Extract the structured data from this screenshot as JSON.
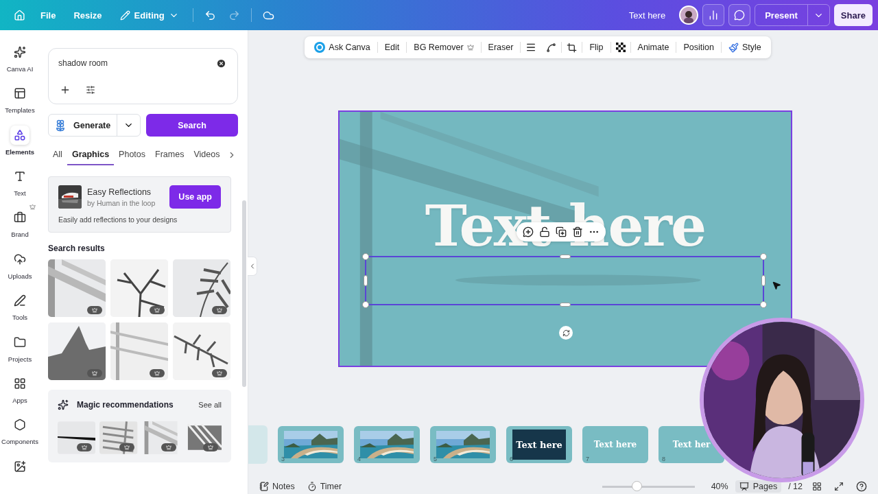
{
  "topbar": {
    "menu": [
      "File",
      "Resize"
    ],
    "mode": "Editing",
    "design_title": "Text here",
    "present": "Present",
    "share": "Share"
  },
  "rail": [
    {
      "label": "Canva AI",
      "selected": false,
      "premium": false
    },
    {
      "label": "Templates",
      "selected": false,
      "premium": false
    },
    {
      "label": "Elements",
      "selected": true,
      "premium": false
    },
    {
      "label": "Text",
      "selected": false,
      "premium": false
    },
    {
      "label": "Brand",
      "selected": false,
      "premium": true
    },
    {
      "label": "Uploads",
      "selected": false,
      "premium": false
    },
    {
      "label": "Tools",
      "selected": false,
      "premium": false
    },
    {
      "label": "Projects",
      "selected": false,
      "premium": false
    },
    {
      "label": "Apps",
      "selected": false,
      "premium": false
    },
    {
      "label": "Components",
      "selected": false,
      "premium": false
    },
    {
      "selected": false,
      "premium": false
    }
  ],
  "panel": {
    "search": {
      "value": "shadow room"
    },
    "generate": "Generate",
    "search_button": "Search",
    "tabs": [
      {
        "label": "All",
        "selected": false
      },
      {
        "label": "Graphics",
        "selected": true
      },
      {
        "label": "Photos",
        "selected": false
      },
      {
        "label": "Frames",
        "selected": false
      },
      {
        "label": "Videos",
        "selected": false
      }
    ],
    "app_card": {
      "title": "Easy Reflections",
      "author": "by Human in the loop",
      "button": "Use app",
      "description": "Easily add reflections to your designs"
    },
    "results_title": "Search results",
    "results": [
      {
        "kind": "window"
      },
      {
        "kind": "branches"
      },
      {
        "kind": "palm"
      },
      {
        "kind": "city"
      },
      {
        "kind": "frame"
      },
      {
        "kind": "leaves"
      }
    ],
    "magic": {
      "title": "Magic recommendations",
      "link": "See all",
      "items": [
        {
          "kind": "line"
        },
        {
          "kind": "blinds"
        },
        {
          "kind": "window"
        },
        {
          "kind": "stripes"
        }
      ]
    }
  },
  "toolbar": [
    {
      "label": "Ask Canva",
      "kind": "ask"
    },
    {
      "label": "Edit",
      "kind": "text"
    },
    {
      "label": "BG Remover",
      "kind": "premium"
    },
    {
      "label": "Eraser",
      "kind": "text"
    },
    {
      "label": "Flip",
      "kind": "text"
    },
    {
      "label": "Animate",
      "kind": "text"
    },
    {
      "label": "Position",
      "kind": "text"
    },
    {
      "label": "Style",
      "kind": "style"
    }
  ],
  "canvas": {
    "heading": "Text here"
  },
  "pages": [
    {
      "number": "3",
      "kind": "picture"
    },
    {
      "number": "4",
      "kind": "picture"
    },
    {
      "number": "5",
      "kind": "picture"
    },
    {
      "number": "6",
      "kind": "dark",
      "text": "Text here"
    },
    {
      "number": "7",
      "kind": "light",
      "text": "Text here"
    },
    {
      "number": "8",
      "kind": "light",
      "text": "Text her"
    }
  ],
  "status": {
    "notes": "Notes",
    "timer": "Timer",
    "zoom": {
      "level": 0.37,
      "reading": "40%"
    },
    "pages": "Pages",
    "page_count": "/ 12"
  }
}
